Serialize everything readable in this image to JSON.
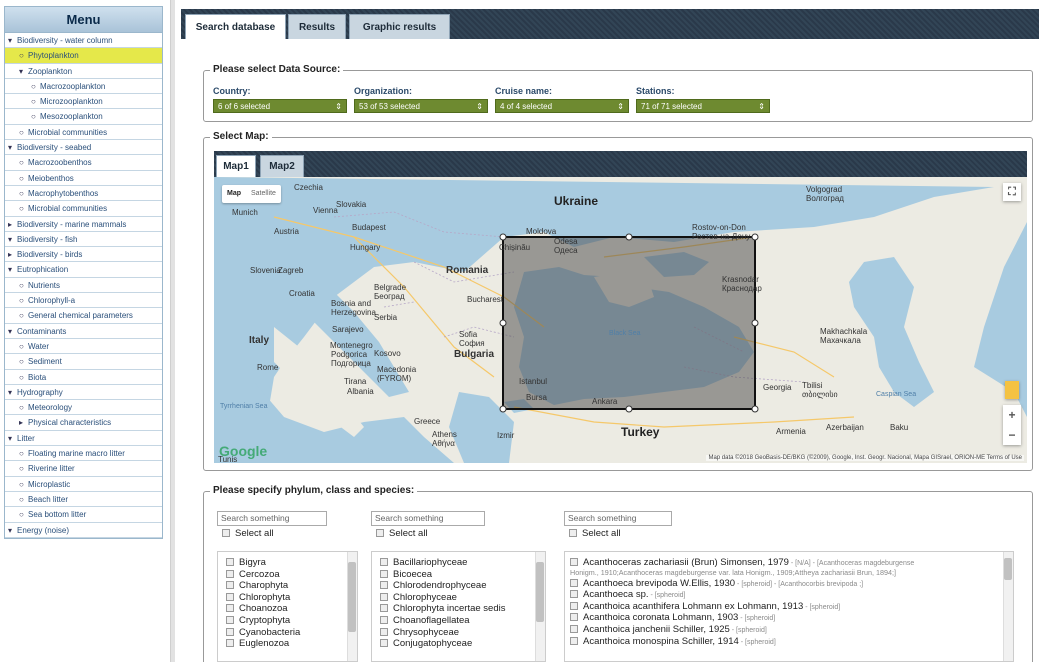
{
  "menu": {
    "title": "Menu",
    "items": [
      {
        "label": "Biodiversity - water column",
        "level": 1,
        "marker": "▾"
      },
      {
        "label": "Phytoplankton",
        "level": 2,
        "marker": "○",
        "active": true
      },
      {
        "label": "Zooplankton",
        "level": 2,
        "marker": "▾"
      },
      {
        "label": "Macrozooplankton",
        "level": 3,
        "marker": "○"
      },
      {
        "label": "Microzooplankton",
        "level": 3,
        "marker": "○"
      },
      {
        "label": "Mesozooplankton",
        "level": 3,
        "marker": "○"
      },
      {
        "label": "Microbial communities",
        "level": 2,
        "marker": "○"
      },
      {
        "label": "Biodiversity - seabed",
        "level": 1,
        "marker": "▾"
      },
      {
        "label": "Macrozoobenthos",
        "level": 2,
        "marker": "○"
      },
      {
        "label": "Meiobenthos",
        "level": 2,
        "marker": "○"
      },
      {
        "label": "Macrophytobenthos",
        "level": 2,
        "marker": "○"
      },
      {
        "label": "Microbial communities",
        "level": 2,
        "marker": "○"
      },
      {
        "label": "Biodiversity - marine mammals",
        "level": 1,
        "marker": "▸"
      },
      {
        "label": "Biodiversity - fish",
        "level": 1,
        "marker": "▾"
      },
      {
        "label": "Biodiversity - birds",
        "level": 1,
        "marker": "▸"
      },
      {
        "label": "Eutrophication",
        "level": 1,
        "marker": "▾"
      },
      {
        "label": "Nutrients",
        "level": 2,
        "marker": "○"
      },
      {
        "label": "Chlorophyll-a",
        "level": 2,
        "marker": "○"
      },
      {
        "label": "General chemical parameters",
        "level": 2,
        "marker": "○"
      },
      {
        "label": "Contaminants",
        "level": 1,
        "marker": "▾"
      },
      {
        "label": "Water",
        "level": 2,
        "marker": "○"
      },
      {
        "label": "Sediment",
        "level": 2,
        "marker": "○"
      },
      {
        "label": "Biota",
        "level": 2,
        "marker": "○"
      },
      {
        "label": "Hydrography",
        "level": 1,
        "marker": "▾"
      },
      {
        "label": "Meteorology",
        "level": 2,
        "marker": "○"
      },
      {
        "label": "Physical characteristics",
        "level": 2,
        "marker": "▸"
      },
      {
        "label": "Litter",
        "level": 1,
        "marker": "▾"
      },
      {
        "label": "Floating marine macro litter",
        "level": 2,
        "marker": "○"
      },
      {
        "label": "Riverine litter",
        "level": 2,
        "marker": "○"
      },
      {
        "label": "Microplastic",
        "level": 2,
        "marker": "○"
      },
      {
        "label": "Beach litter",
        "level": 2,
        "marker": "○"
      },
      {
        "label": "Sea bottom litter",
        "level": 2,
        "marker": "○"
      },
      {
        "label": "Energy (noise)",
        "level": 1,
        "marker": "▾"
      }
    ]
  },
  "tabs": {
    "search": "Search database",
    "results": "Results",
    "graphic": "Graphic results"
  },
  "datasource": {
    "legend": "Please select Data Source:",
    "country_label": "Country:",
    "country_value": "6 of 6 selected",
    "org_label": "Organization:",
    "org_value": "53 of 53 selected",
    "cruise_label": "Cruise name:",
    "cruise_value": "4 of 4 selected",
    "stations_label": "Stations:",
    "stations_value": "71 of 71 selected"
  },
  "map": {
    "legend": "Select Map:",
    "tab1": "Map1",
    "tab2": "Map2",
    "type_map": "Map",
    "type_satellite": "Satellite",
    "places": {
      "czechia": "Czechia",
      "slovakia": "Slovakia",
      "munich": "Munich",
      "vienna": "Vienna",
      "austria": "Austria",
      "budapest": "Budapest",
      "hungary": "Hungary",
      "ukraine": "Ukraine",
      "moldova": "Moldova",
      "chisinau": "Chișinău",
      "odesa": "Odesa\nОдеса",
      "volgograd": "Volgograd\nВолгоград",
      "rostov": "Rostov-on-Don\nРостов-на-Дону",
      "krasnodar": "Krasnodar\nКраснодар",
      "slovenia": "Slovenia",
      "zagreb": "Zagreb",
      "croatia": "Croatia",
      "belgrade": "Belgrade\nБеоград",
      "bosnia": "Bosnia and\nHerzegovina",
      "serbia": "Serbia",
      "sarajevo": "Sarajevo",
      "romania": "Romania",
      "bucharest": "Bucharest",
      "italy": "Italy",
      "montenegro": "Montenegro",
      "podgorica": "Podgorica\nПодгорица",
      "kosovo": "Kosovo",
      "sofia": "Sofia\nСофия",
      "bulgaria": "Bulgaria",
      "rome": "Rome",
      "macedonia": "Macedonia\n(FYROM)",
      "tirana": "Tirana",
      "albania": "Albania",
      "black_sea": "Black Sea",
      "istanbul": "Istanbul",
      "bursa": "Bursa",
      "ankara": "Ankara",
      "izmir": "Izmir",
      "greece": "Greece",
      "athens": "Athens\nΑθήνα",
      "turkey": "Turkey",
      "georgia": "Georgia",
      "tbilisi": "Tbilisi\nთბილისი",
      "makhachkala": "Makhachkala\nМахачкала",
      "caspian": "Caspian Sea",
      "armenia": "Armenia",
      "azerbaijan": "Azerbaijan",
      "baku": "Baku",
      "tyrrhenian": "Tyrrhenian Sea",
      "tunis": "Tunis"
    },
    "google": "Google",
    "attribution": "Map data ©2018 GeoBasis-DE/BKG (©2009), Google, Inst. Geogr. Nacional, Mapa GISrael, ORION-ME   Terms of Use",
    "zoom_in": "+",
    "zoom_out": "−",
    "fullscreen": "⛶"
  },
  "phylum": {
    "legend": "Please specify phylum, class and species:",
    "search_placeholder": "Search something",
    "select_all": "Select all",
    "phyla": [
      "Bigyra",
      "Cercozoa",
      "Charophyta",
      "Chlorophyta",
      "Choanozoa",
      "Cryptophyta",
      "Cyanobacteria",
      "Euglenozoa"
    ],
    "classes": [
      "Bacillariophyceae",
      "Bicoecea",
      "Chlorodendrophyceae",
      "Chlorophyceae",
      "Chlorophyta incertae sedis",
      "Choanoflagellatea",
      "Chrysophyceae",
      "Conjugatophyceae"
    ],
    "species": [
      {
        "name": "Acanthoceras zachariasii (Brun) Simonsen, 1979",
        "tag": " - [N/A] - [Acanthoceras magdeburgense"
      },
      {
        "wrap": "Honigm., 1910;Acanthoceras magdeburgense var. lata Honigm., 1909;Attheya zachariasii Brun, 1894;]"
      },
      {
        "name": "Acanthoeca brevipoda W.Ellis, 1930",
        "tag": " - [spheroid] - [Acanthocorbis brevipoda ;]"
      },
      {
        "name": "Acanthoeca sp.",
        "tag": " - [spheroid]"
      },
      {
        "name": "Acanthoica acanthifera Lohmann ex Lohmann, 1913",
        "tag": " - [spheroid]"
      },
      {
        "name": "Acanthoica coronata Lohmann, 1903",
        "tag": " - [spheroid]"
      },
      {
        "name": "Acanthoica janchenii Schiller, 1925",
        "tag": " - [spheroid]"
      },
      {
        "name": "Acanthoica monospina Schiller, 1914",
        "tag": " - [spheroid]"
      }
    ]
  }
}
